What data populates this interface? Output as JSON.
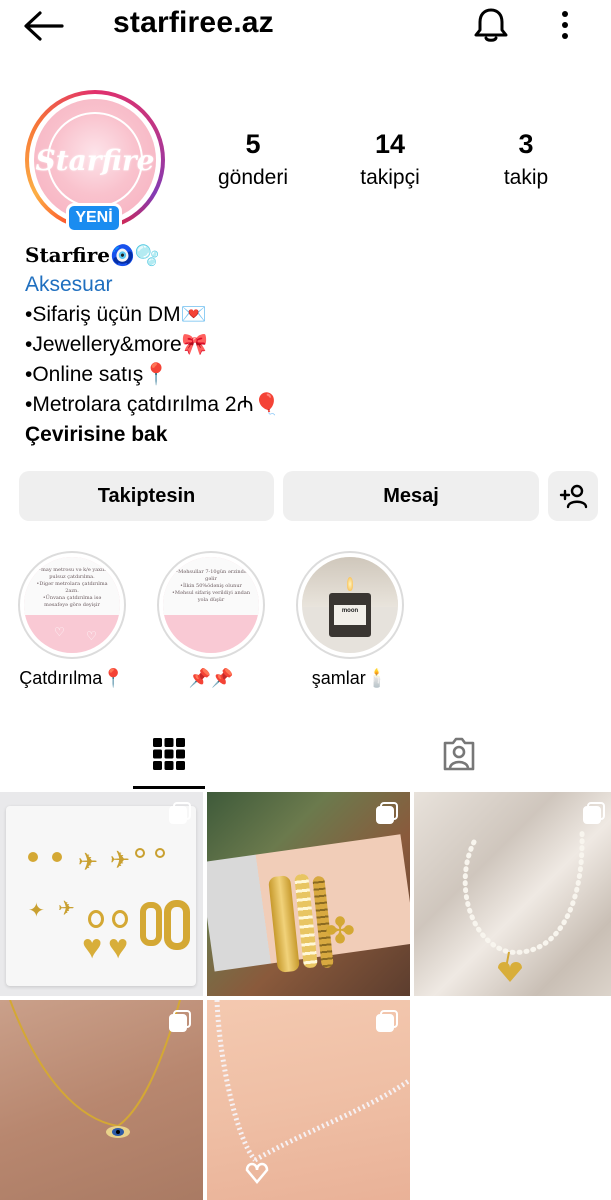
{
  "header": {
    "title": "starfiree.az"
  },
  "profile": {
    "avatar_text": "Starfire",
    "new_badge": "YENİ",
    "stats": [
      {
        "value": "5",
        "label": "gönderi"
      },
      {
        "value": "14",
        "label": "takipçi"
      },
      {
        "value": "3",
        "label": "takip"
      }
    ],
    "name": "Starfire🧿🫧",
    "category": "Aksesuar",
    "bio_lines": [
      "•Sifariş üçün DM💌",
      "•Jewellery&more🎀",
      "•Online satış📍",
      "•Metrolara çatdırılma 2₼🎈"
    ],
    "see_translation": "Çevirisine bak"
  },
  "actions": {
    "follow_label": "Takiptesin",
    "message_label": "Mesaj"
  },
  "highlights": [
    {
      "label": "Çatdırılma📍",
      "text": [
        "•may metrosu və k/e yaxın",
        "pulsuz çatdırılma.",
        "•Digər metrolara çatdırılma",
        "2azn.",
        "•Ünvana çatdırılma isə",
        "məsafəyə görə dəyişir"
      ]
    },
    {
      "label": "📌📌",
      "text": [
        "•Məhsullar 7-10gün ərzində",
        "gəlir",
        "•İlkin 50%ödəniş olunur",
        "•Məhsul sifariş verildiyi andan",
        "yola düşür"
      ]
    },
    {
      "label": "şamlar🕯️",
      "text": [
        "moon"
      ]
    }
  ],
  "tabs": [
    {
      "name": "grid-icon",
      "active": true
    },
    {
      "name": "tagged-icon",
      "active": false
    }
  ],
  "posts": [
    {
      "name": "earrings-set"
    },
    {
      "name": "gold-bracelets"
    },
    {
      "name": "pearl-necklace"
    },
    {
      "name": "evil-eye-necklace"
    },
    {
      "name": "heart-tennis-necklace"
    }
  ],
  "colors": {
    "accent_blue": "#1a8cf0",
    "category_link": "#1f6fbf",
    "button_bg": "#efefef",
    "avatar_pink": "#f6aebe"
  }
}
